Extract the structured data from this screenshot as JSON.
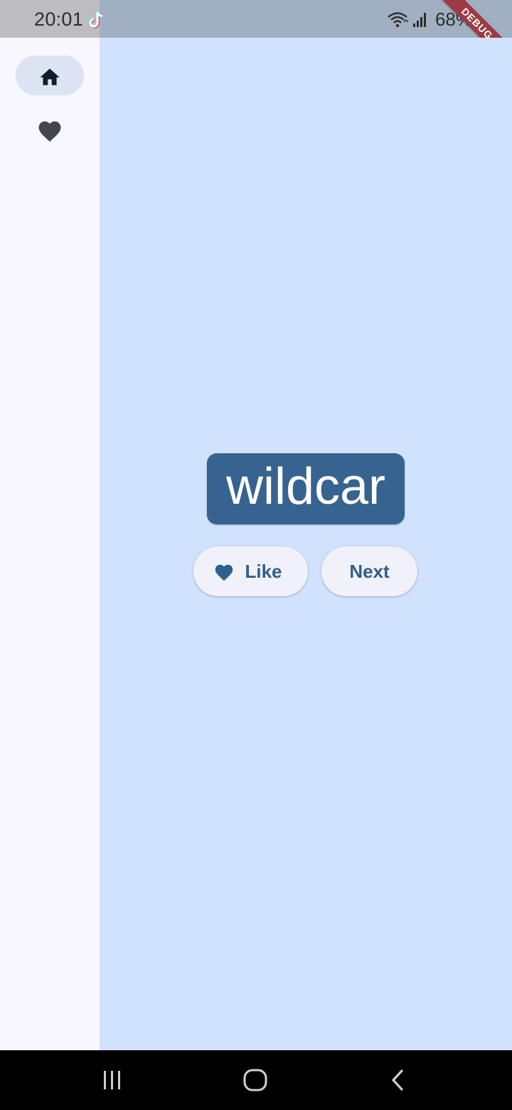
{
  "status_bar": {
    "time": "20:01",
    "app_icon": "tiktok-icon",
    "wifi_icon": "wifi-icon",
    "signal_icon": "cell-signal-icon",
    "battery": "68%",
    "debug_banner": "DEBUG"
  },
  "nav_rail": {
    "items": [
      {
        "icon": "home-icon",
        "selected": true
      },
      {
        "icon": "heart-icon",
        "selected": false
      }
    ]
  },
  "main": {
    "word": "wildcar",
    "like_button": {
      "icon": "heart-icon",
      "label": "Like"
    },
    "next_button": {
      "label": "Next"
    }
  },
  "system_nav": {
    "recents": "recents-icon",
    "home": "home-circle-icon",
    "back": "back-chevron-icon"
  },
  "colors": {
    "primary": "#366390",
    "background": "#d0e2fd",
    "rail_background": "#f8f7fd",
    "rail_indicator": "#dce3f2",
    "button_background": "#f1f2f9",
    "button_text": "#2f5f8d",
    "debug_ribbon": "#9c3b43"
  }
}
